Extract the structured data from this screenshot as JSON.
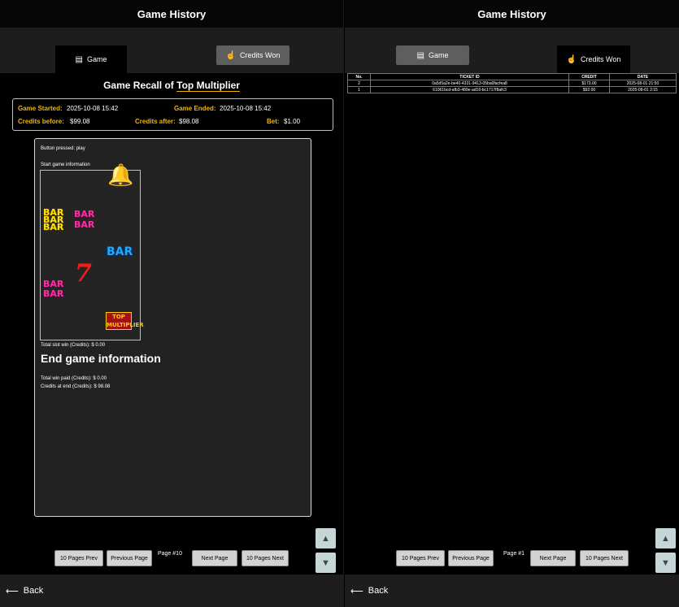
{
  "left": {
    "title": "Game History",
    "tabs": {
      "game": "Game",
      "credits": "Credits Won"
    },
    "recall_prefix": "Game Recall of ",
    "game_name": "Top Multiplier",
    "info": {
      "started_label": "Game Started:",
      "started_value": "2025-10-08 15:42",
      "ended_label": "Game Ended:",
      "ended_value": "2025-10-08 15:42",
      "before_label": "Credits before:",
      "before_value": "$99.08",
      "after_label": "Credits after:",
      "after_value": "$98.08",
      "bet_label": "Bet:",
      "bet_value": "$1.00"
    },
    "detail": {
      "button_pressed": "Button pressed: play",
      "start_info": "Start game information",
      "symbols": {
        "bar": "BAR",
        "seven": "7",
        "bell": "🔔",
        "top": "TOP MULTIPLIER"
      },
      "slot_win": "Total slot win (Credits): $ 0.00",
      "end_heading": "End game information",
      "total_paid": "Total win paid (Credits): $ 0.00",
      "credits_end": "Credits at end (Credits): $ 98.08"
    },
    "pager": {
      "prev10": "10 Pages Prev",
      "prev": "Previous Page",
      "page": "Page #10",
      "next": "Next Page",
      "next10": "10 Pages Next"
    },
    "back": "Back"
  },
  "right": {
    "title": "Game History",
    "tabs": {
      "game": "Game",
      "credits": "Credits Won"
    },
    "table": {
      "headers": [
        "No.",
        "TICKET ID",
        "CREDIT",
        "DATE"
      ],
      "rows": [
        [
          "2",
          "0a5d5a2e-be40-4331-9413-05ba0facfea8",
          "$173.00",
          "2025-08-01 21:50"
        ],
        [
          "1",
          "61061bcd-afb3-480e-ad16-bc1717f8afc3",
          "$92.00",
          "2025-08-01 2:15"
        ]
      ]
    },
    "pager": {
      "prev10": "10 Pages Prev",
      "prev": "Previous Page",
      "page": "Page #1",
      "next": "Next Page",
      "next10": "10 Pages Next"
    },
    "back": "Back"
  },
  "icons": {
    "game": "game-icon",
    "credits": "hand-coin-icon",
    "up": "arrow-up-icon",
    "down": "arrow-down-icon",
    "back": "arrow-left-icon"
  },
  "colors": {
    "accent": "#f0b400",
    "tab_inactive": "#5e5e5e",
    "button": "#d3d3d3",
    "arrow_button": "#c6d6d6"
  }
}
